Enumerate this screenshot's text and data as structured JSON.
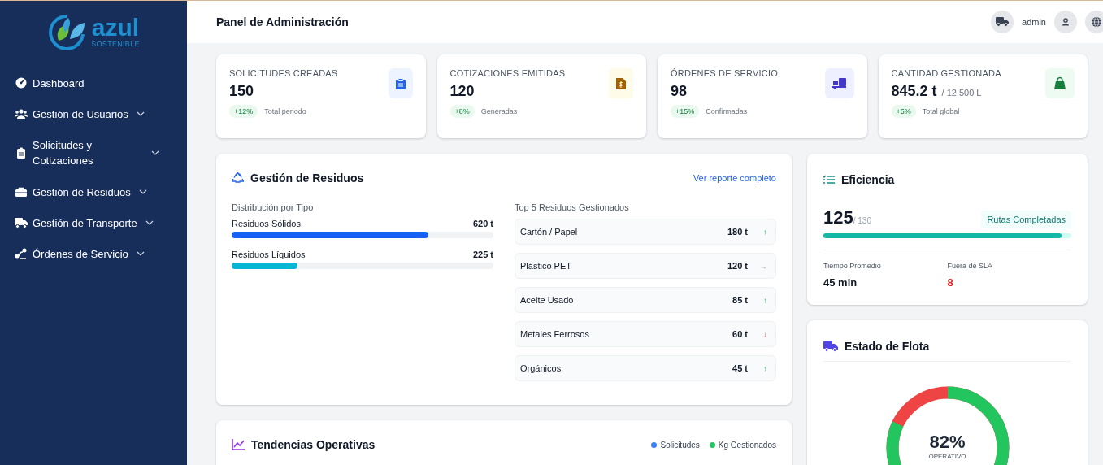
{
  "sidebar": {
    "logo": {
      "name": "azul",
      "tagline": "SOSTENIBLE"
    },
    "items": [
      {
        "label": "Dashboard",
        "expandable": false
      },
      {
        "label": "Gestión de Usuarios",
        "expandable": true
      },
      {
        "label": "Solicitudes y Cotizaciones",
        "expandable": true
      },
      {
        "label": "Gestión de Residuos",
        "expandable": true
      },
      {
        "label": "Gestión de Transporte",
        "expandable": true
      },
      {
        "label": "Órdenes de Servicio",
        "expandable": true
      }
    ]
  },
  "header": {
    "title": "Panel de Administración",
    "user": "admin"
  },
  "stats": [
    {
      "label": "SOLICITUDES CREADAS",
      "value": "150",
      "delta": "+12%",
      "note": "Total periodo"
    },
    {
      "label": "COTIZACIONES EMITIDAS",
      "value": "120",
      "delta": "+8%",
      "note": "Generadas"
    },
    {
      "label": "ÓRDENES DE SERVICIO",
      "value": "98",
      "delta": "+15%",
      "note": "Confirmadas"
    },
    {
      "label": "CANTIDAD GESTIONADA",
      "value": "845.2 t",
      "suffix": "/ 12,500 L",
      "delta": "+5%",
      "note": "Total global"
    }
  ],
  "waste": {
    "title": "Gestión de Residuos",
    "link": "Ver reporte completo",
    "distribution": {
      "title": "Distribución por Tipo",
      "items": [
        {
          "label": "Residuos Sólidos",
          "value": "620 t",
          "level": 0.75,
          "color": "#1660f5"
        },
        {
          "label": "Residuos Líquidos",
          "value": "225 t",
          "level": 0.25,
          "color": "#06b6d4"
        }
      ]
    },
    "top": {
      "title": "Top 5 Residuos Gestionados",
      "items": [
        {
          "label": "Cartón / Papel",
          "value": "180 t",
          "arrow": "↑",
          "kind": "up"
        },
        {
          "label": "Plástico PET",
          "value": "120 t",
          "arrow": "→",
          "kind": "flat"
        },
        {
          "label": "Aceite Usado",
          "value": "85 t",
          "arrow": "↑",
          "kind": "up"
        },
        {
          "label": "Metales Ferrosos",
          "value": "60 t",
          "arrow": "↓",
          "kind": "down"
        },
        {
          "label": "Orgánicos",
          "value": "45 t",
          "arrow": "↑",
          "kind": "up"
        }
      ]
    }
  },
  "efficiency": {
    "title": "Eficiencia",
    "value": "125",
    "total": "/ 130",
    "badge": "Rutas Completadas",
    "level": 0.96,
    "metrics": [
      {
        "label": "Tiempo Promedio",
        "value": "45 min",
        "alert": false
      },
      {
        "label": "Fuera de SLA",
        "value": "8",
        "alert": true
      }
    ]
  },
  "fleet": {
    "title": "Estado de Flota",
    "value": "82%",
    "caption": "OPERATIVO"
  },
  "trends": {
    "title": "Tendencias Operativas",
    "legend": [
      {
        "label": "Solicitudes",
        "color": "#3b82f6"
      },
      {
        "label": "Kg Gestionados",
        "color": "#22c55e"
      }
    ]
  }
}
